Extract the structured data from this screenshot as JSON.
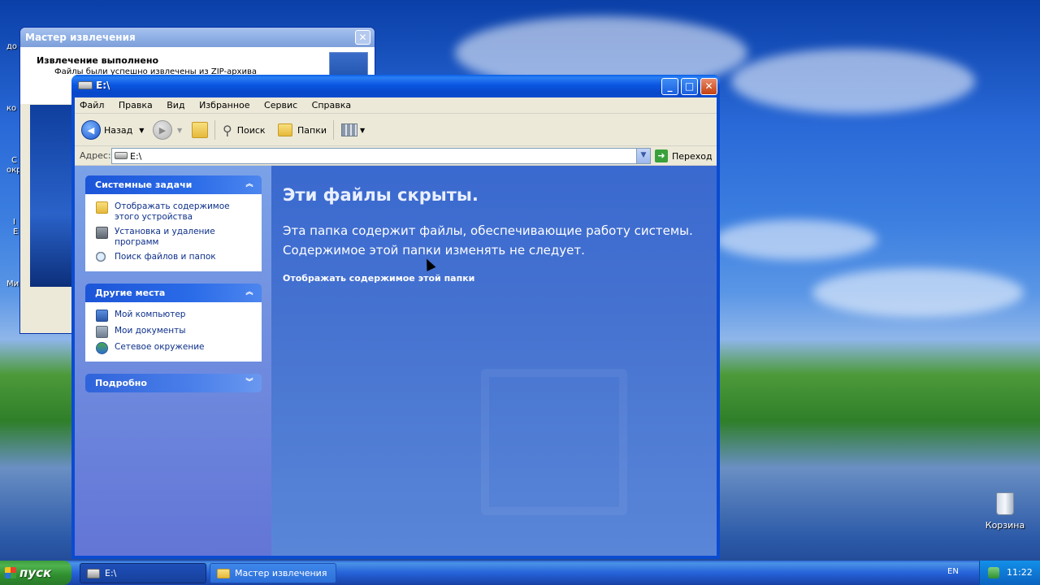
{
  "desktop": {
    "recycle_label": "Корзина",
    "partial_labels": [
      "до",
      "ко",
      "С",
      "окр",
      "I",
      "E",
      "Ми"
    ]
  },
  "wizard": {
    "title": "Мастер извлечения",
    "heading": "Извлечение выполнено",
    "subheading": "Файлы были успешно извлечены из ZIP-архива"
  },
  "explorer": {
    "title": "E:\\",
    "menu": [
      "Файл",
      "Правка",
      "Вид",
      "Избранное",
      "Сервис",
      "Справка"
    ],
    "toolbar": {
      "back": "Назад",
      "search": "Поиск",
      "folders": "Папки"
    },
    "address": {
      "label": "Адрес:",
      "value": "E:\\",
      "go": "Переход"
    },
    "left": {
      "system_tasks": {
        "header": "Системные задачи",
        "items": [
          "Отображать содержимое этого устройства",
          "Установка и удаление программ",
          "Поиск файлов и папок"
        ]
      },
      "other_places": {
        "header": "Другие места",
        "items": [
          "Мой компьютер",
          "Мои документы",
          "Сетевое окружение"
        ]
      },
      "details": {
        "header": "Подробно"
      }
    },
    "main": {
      "heading": "Эти файлы скрыты.",
      "paragraph": "Эта папка содержит файлы, обеспечивающие работу системы. Содержимое этой папки изменять не следует.",
      "link": "Отображать содержимое этой папки"
    }
  },
  "taskbar": {
    "start": "пуск",
    "buttons": [
      {
        "label": "E:\\",
        "active": true
      },
      {
        "label": "Мастер извлечения",
        "active": false
      }
    ],
    "lang": "EN",
    "clock": "11:22"
  }
}
